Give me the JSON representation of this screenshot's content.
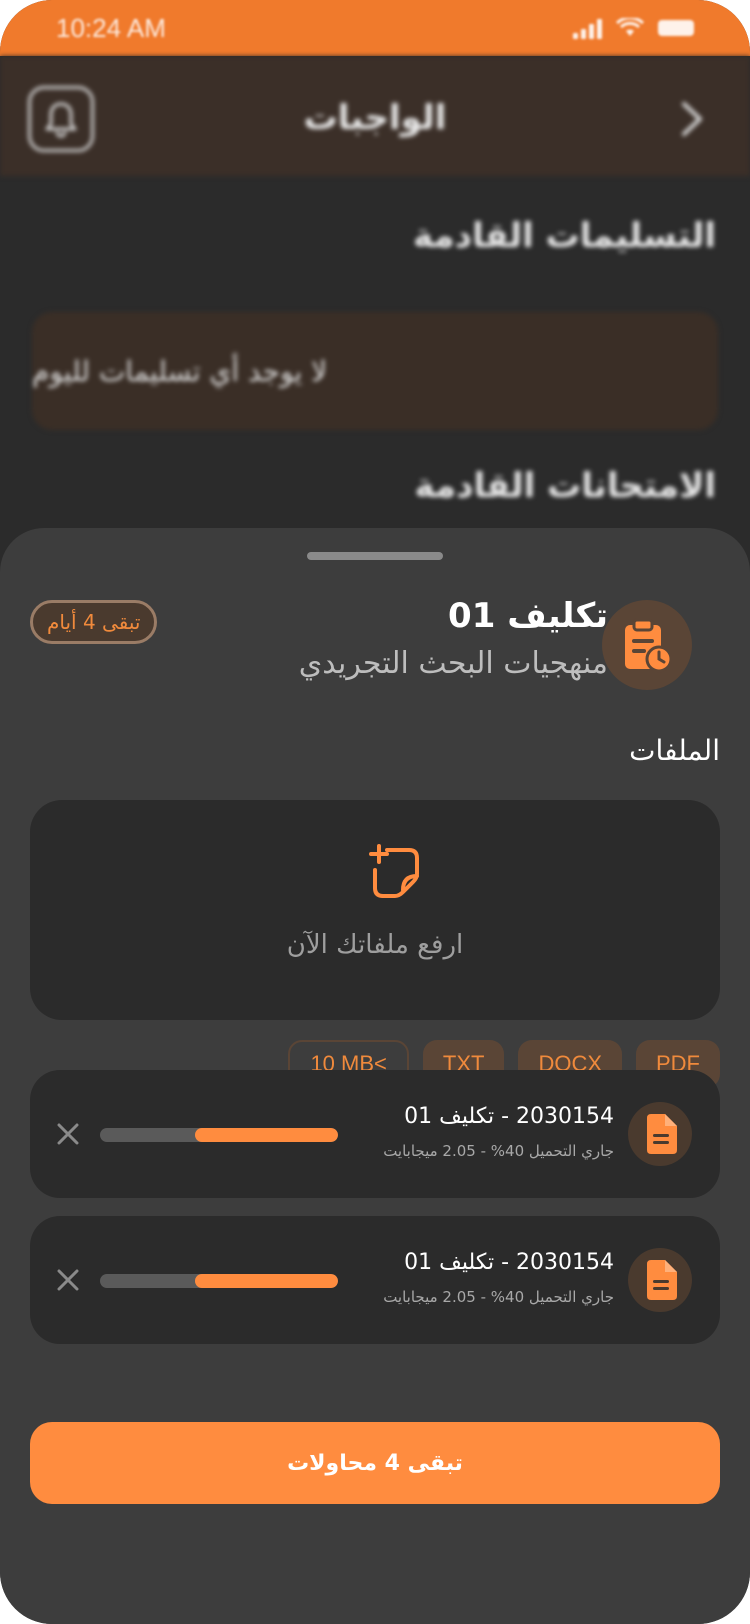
{
  "status_bar": {
    "time": "10:24 AM"
  },
  "header": {
    "title": "الواجبات"
  },
  "background": {
    "upcoming_submissions_heading": "التسليمات القادمة",
    "no_submissions_text": "لا يوجد أي تسليمات لليوم",
    "upcoming_exams_heading": "الامتحانات القادمة"
  },
  "sheet": {
    "assignment_title": "تكليف 01",
    "course_name": "منهجيات البحث التجريدي",
    "days_left_badge": "تبقى 4 أيام",
    "files_label": "الملفات",
    "upload_text": "ارفع ملفاتك الآن",
    "chips": [
      "PDF",
      "DOCX",
      "TXT",
      "10 MB<"
    ],
    "files": [
      {
        "name": "2030154 - تكليف 01",
        "status": "جاري التحميل 40% - 2.05 ميجابايت",
        "progress": 0.6
      },
      {
        "name": "2030154 - تكليف 01",
        "status": "جاري التحميل 40% - 2.05 ميجابايت",
        "progress": 0.6
      }
    ],
    "cta_label": "تبقى 4  محاولات"
  },
  "colors": {
    "accent": "#ff8c3f",
    "status_bar": "#f07a2c",
    "sheet_bg": "#3d3d3d",
    "card_bg": "#2b2b2b"
  },
  "icons": [
    "bell-icon",
    "chevron-right-icon",
    "assignment-clock-icon",
    "file-add-icon",
    "document-icon",
    "close-icon"
  ]
}
